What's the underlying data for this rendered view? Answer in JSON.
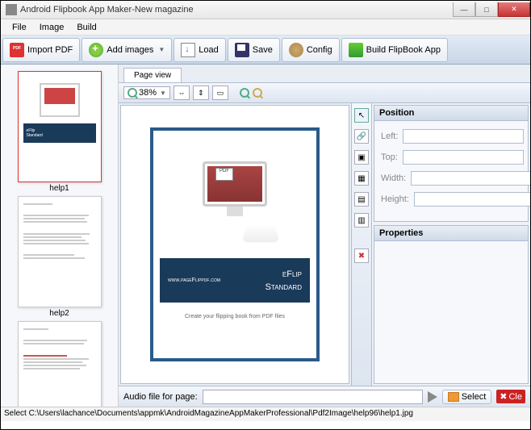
{
  "window": {
    "title": "Android Flipbook App Maker-New magazine"
  },
  "menu": {
    "file": "File",
    "image": "Image",
    "build": "Build"
  },
  "toolbar": {
    "import_pdf": "Import PDF",
    "add_images": "Add images",
    "load": "Load",
    "save": "Save",
    "config": "Config",
    "build_app": "Build FlipBook App"
  },
  "sidebar": {
    "thumbs": [
      {
        "title": "help1"
      },
      {
        "title": "help2"
      },
      {
        "title": ""
      }
    ]
  },
  "pageview": {
    "tab": "Page view",
    "zoom": "38%",
    "doc": {
      "url": "www.pageFlippdf.com",
      "brand1": "eFlip",
      "brand2": "Standard",
      "footer": "Create your flipping book from PDF files"
    }
  },
  "props": {
    "position_hdr": "Position",
    "left": "Left:",
    "top": "Top:",
    "width": "Width:",
    "height": "Height:",
    "properties_hdr": "Properties",
    "left_val": "",
    "top_val": "",
    "width_val": "",
    "height_val": ""
  },
  "audio": {
    "label": "Audio file for page:",
    "value": "",
    "select": "Select",
    "clear": "Cle"
  },
  "status": "Select C:\\Users\\lachance\\Documents\\appmk\\AndroidMagazineAppMakerProfessional\\Pdf2Image\\help96\\help1.jpg"
}
